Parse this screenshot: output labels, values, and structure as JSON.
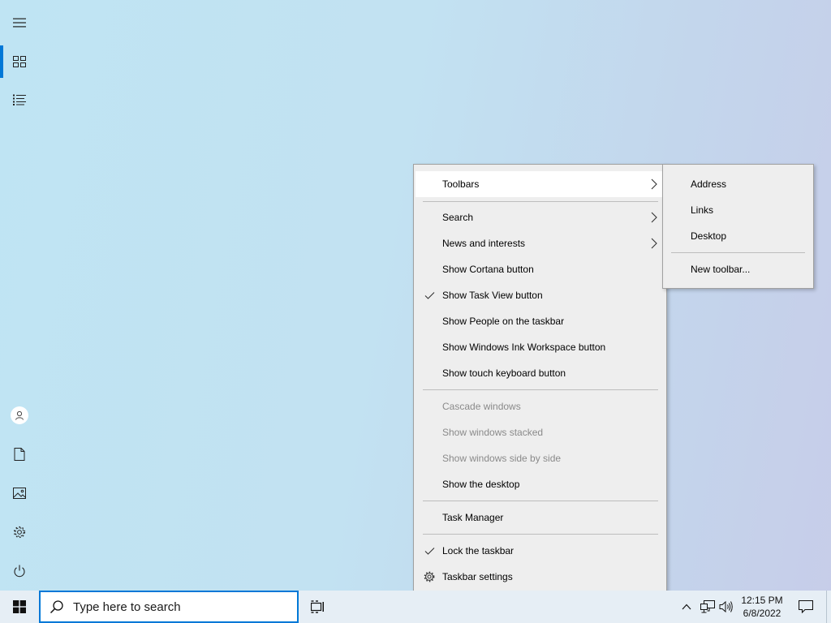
{
  "start_rail": {
    "items": [
      {
        "icon": "hamburger-icon"
      },
      {
        "icon": "tiles-icon",
        "active": true
      },
      {
        "icon": "all-apps-list-icon"
      },
      {
        "icon": "user-icon"
      },
      {
        "icon": "documents-icon"
      },
      {
        "icon": "pictures-icon"
      },
      {
        "icon": "settings-gear-icon"
      },
      {
        "icon": "power-icon"
      }
    ]
  },
  "context_menu": {
    "toolbars": "Toolbars",
    "search": "Search",
    "news": "News and interests",
    "cortana": "Show Cortana button",
    "task_view": "Show Task View button",
    "task_view_checked": true,
    "people": "Show People on the taskbar",
    "ink": "Show Windows Ink Workspace button",
    "touch_keyboard": "Show touch keyboard button",
    "cascade": "Cascade windows",
    "stacked": "Show windows stacked",
    "side_by_side": "Show windows side by side",
    "show_desktop": "Show the desktop",
    "task_manager": "Task Manager",
    "lock": "Lock the taskbar",
    "lock_checked": true,
    "settings": "Taskbar settings"
  },
  "toolbars_submenu": {
    "address": "Address",
    "links": "Links",
    "desktop": "Desktop",
    "new_toolbar": "New toolbar..."
  },
  "taskbar": {
    "search_placeholder": "Type here to search",
    "clock_time": "12:15 PM",
    "clock_date": "6/8/2022",
    "accent_color": "#0078d7"
  }
}
